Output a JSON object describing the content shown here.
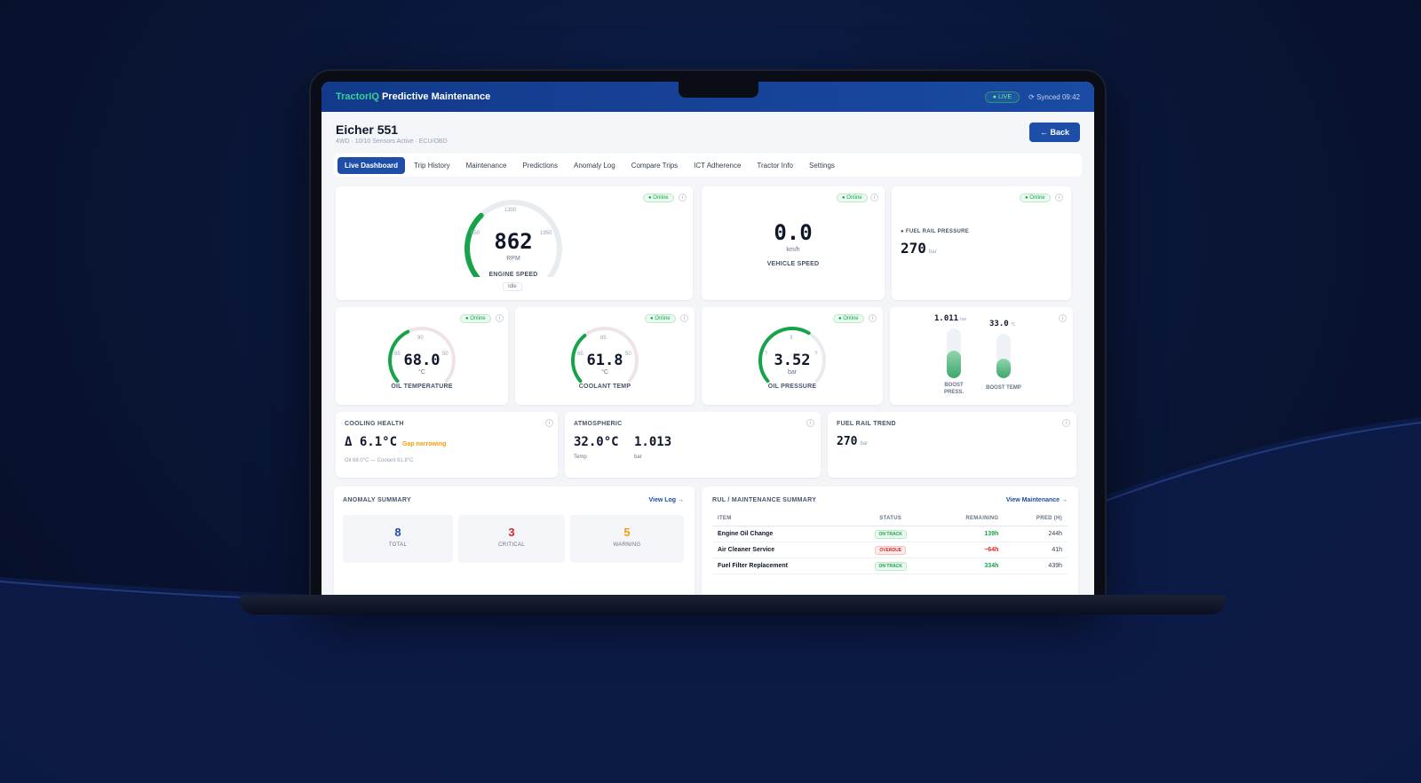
{
  "app": {
    "brand_part1": "TractorIQ",
    "brand_part2": "Predictive Maintenance",
    "live_label": "● LIVE",
    "synced": "⟳ Synced 09:42"
  },
  "vehicle": {
    "name": "Eicher 551",
    "subtitle": "4WD · 10/10 Sensors Active · ECU/OBD",
    "back_label": "← Back"
  },
  "tabs": [
    {
      "label": "Live Dashboard",
      "active": true
    },
    {
      "label": "Trip History"
    },
    {
      "label": "Maintenance"
    },
    {
      "label": "Predictions"
    },
    {
      "label": "Anomaly Log"
    },
    {
      "label": "Compare Trips"
    },
    {
      "label": "ICT Adherence"
    },
    {
      "label": "Tractor Info"
    },
    {
      "label": "Settings"
    }
  ],
  "status_online": "● Online",
  "engine": {
    "value": "862",
    "unit": "RPM",
    "label": "ENGINE SPEED",
    "state": "Idle",
    "tick_left": "650",
    "tick_top": "1300",
    "tick_right": "1950",
    "level": 0.33
  },
  "vehicle_speed": {
    "value": "0.0",
    "unit": "km/h",
    "label": "VEHICLE SPEED"
  },
  "fuel_rail": {
    "label": "● FUEL RAIL PRESSURE",
    "value": "270",
    "unit": "bar"
  },
  "oil_temp": {
    "value": "68.0",
    "unit": "°C",
    "label": "OIL TEMPERATURE",
    "tick_left": "65",
    "tick_top": "90",
    "tick_right": "50",
    "level": 0.4
  },
  "coolant_temp": {
    "value": "61.8",
    "unit": "°C",
    "label": "COOLANT TEMP",
    "tick_left": "65",
    "tick_top": "85",
    "tick_right": "50",
    "level": 0.35
  },
  "oil_pressure": {
    "value": "3.52",
    "unit": "bar",
    "label": "OIL PRESSURE",
    "tick_left": "?",
    "tick_top": "3",
    "tick_right": "?",
    "level": 0.62
  },
  "boost": {
    "press_value": "1.011",
    "press_unit": "bar",
    "press_label_1": "BOOST",
    "press_label_2": "PRESS.",
    "press_level": 0.55,
    "temp_value": "33.0",
    "temp_unit": "°C",
    "temp_label": "BOOST TEMP",
    "temp_level": 0.45
  },
  "cooling_health": {
    "title": "COOLING HEALTH",
    "value": "Δ 6.1°C",
    "note": "Gap narrowing",
    "detail": "Oil 68.0°C — Coolant 61.8°C"
  },
  "atmospheric": {
    "title": "ATMOSPHERIC",
    "temp_value": "32.0°C",
    "temp_label": "Temp",
    "press_value": "1.013",
    "press_label": "bar"
  },
  "fuel_trend": {
    "title": "FUEL RAIL TREND",
    "value": "270",
    "unit": "bar"
  },
  "anomaly": {
    "title": "ANOMALY SUMMARY",
    "link": "View Log →",
    "total": "8",
    "total_label": "TOTAL",
    "critical": "3",
    "critical_label": "CRITICAL",
    "warning": "5",
    "warning_label": "WARNING"
  },
  "rul": {
    "title": "RUL / MAINTENANCE SUMMARY",
    "link": "View Maintenance →",
    "headers": [
      "ITEM",
      "STATUS",
      "REMAINING",
      "PRED (H)"
    ],
    "rows": [
      {
        "item": "Engine Oil Change",
        "status": "ON TRACK",
        "remaining": "139h",
        "pred": "244h"
      },
      {
        "item": "Air Cleaner Service",
        "status": "OVERDUE",
        "remaining": "−64h",
        "pred": "41h"
      },
      {
        "item": "Fuel Filter Replacement",
        "status": "ON TRACK",
        "remaining": "334h",
        "pred": "439h"
      }
    ]
  },
  "colors": {
    "accent": "#1e4ea7",
    "green": "#16a34a",
    "red": "#dc2626",
    "orange": "#f59e0b"
  }
}
